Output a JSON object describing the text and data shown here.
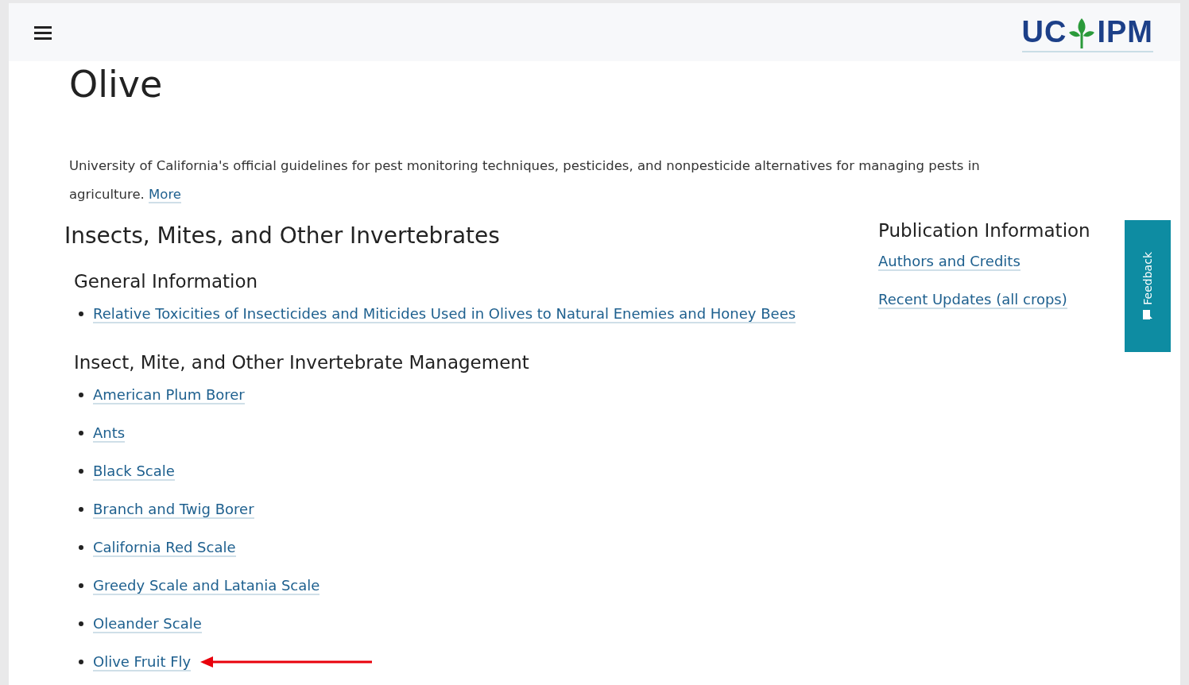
{
  "header": {
    "logo_left": "UC",
    "logo_right": "IPM"
  },
  "page": {
    "title": "Olive",
    "intro": "University of California's official guidelines for pest monitoring techniques, pesticides, and nonpesticide alternatives for managing pests in agriculture.",
    "intro_link": "More"
  },
  "main": {
    "heading": "Insects, Mites, and Other Invertebrates",
    "sections": [
      {
        "heading": "General Information",
        "links": [
          {
            "label": "Relative Toxicities of Insecticides and Miticides Used in Olives to Natural Enemies and Honey Bees",
            "annotated": false
          }
        ]
      },
      {
        "heading": "Insect, Mite, and Other Invertebrate Management",
        "links": [
          {
            "label": "American Plum Borer",
            "annotated": false
          },
          {
            "label": "Ants",
            "annotated": false
          },
          {
            "label": "Black Scale",
            "annotated": false
          },
          {
            "label": "Branch and Twig Borer",
            "annotated": false
          },
          {
            "label": "California Red Scale",
            "annotated": false
          },
          {
            "label": "Greedy Scale and Latania Scale",
            "annotated": false
          },
          {
            "label": "Oleander Scale",
            "annotated": false
          },
          {
            "label": "Olive Fruit Fly",
            "annotated": true
          }
        ]
      }
    ]
  },
  "sidebar": {
    "heading": "Publication Information",
    "links": [
      "Authors and Credits",
      "Recent Updates (all crops)"
    ]
  },
  "feedback_tab": {
    "label": "Feedback"
  }
}
